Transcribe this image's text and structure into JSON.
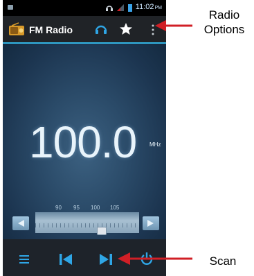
{
  "status_bar": {
    "time": "11:02",
    "ampm": "PM"
  },
  "app_bar": {
    "title": "FM Radio"
  },
  "tuner": {
    "frequency": "100.0",
    "unit": "MHz",
    "scale_labels": [
      "90",
      "95",
      "100",
      "105"
    ]
  },
  "annotations": {
    "radio_options_line1": "Radio",
    "radio_options_line2": "Options",
    "scan": "Scan"
  },
  "colors": {
    "accent": "#33b5e5",
    "icon_blue": "#2fa6e6",
    "arrow_red": "#d11f26"
  },
  "icons": [
    "radio-icon",
    "headphones-icon",
    "star-icon",
    "overflow-menu-icon",
    "list-icon",
    "prev-station-icon",
    "next-station-icon",
    "power-icon"
  ]
}
